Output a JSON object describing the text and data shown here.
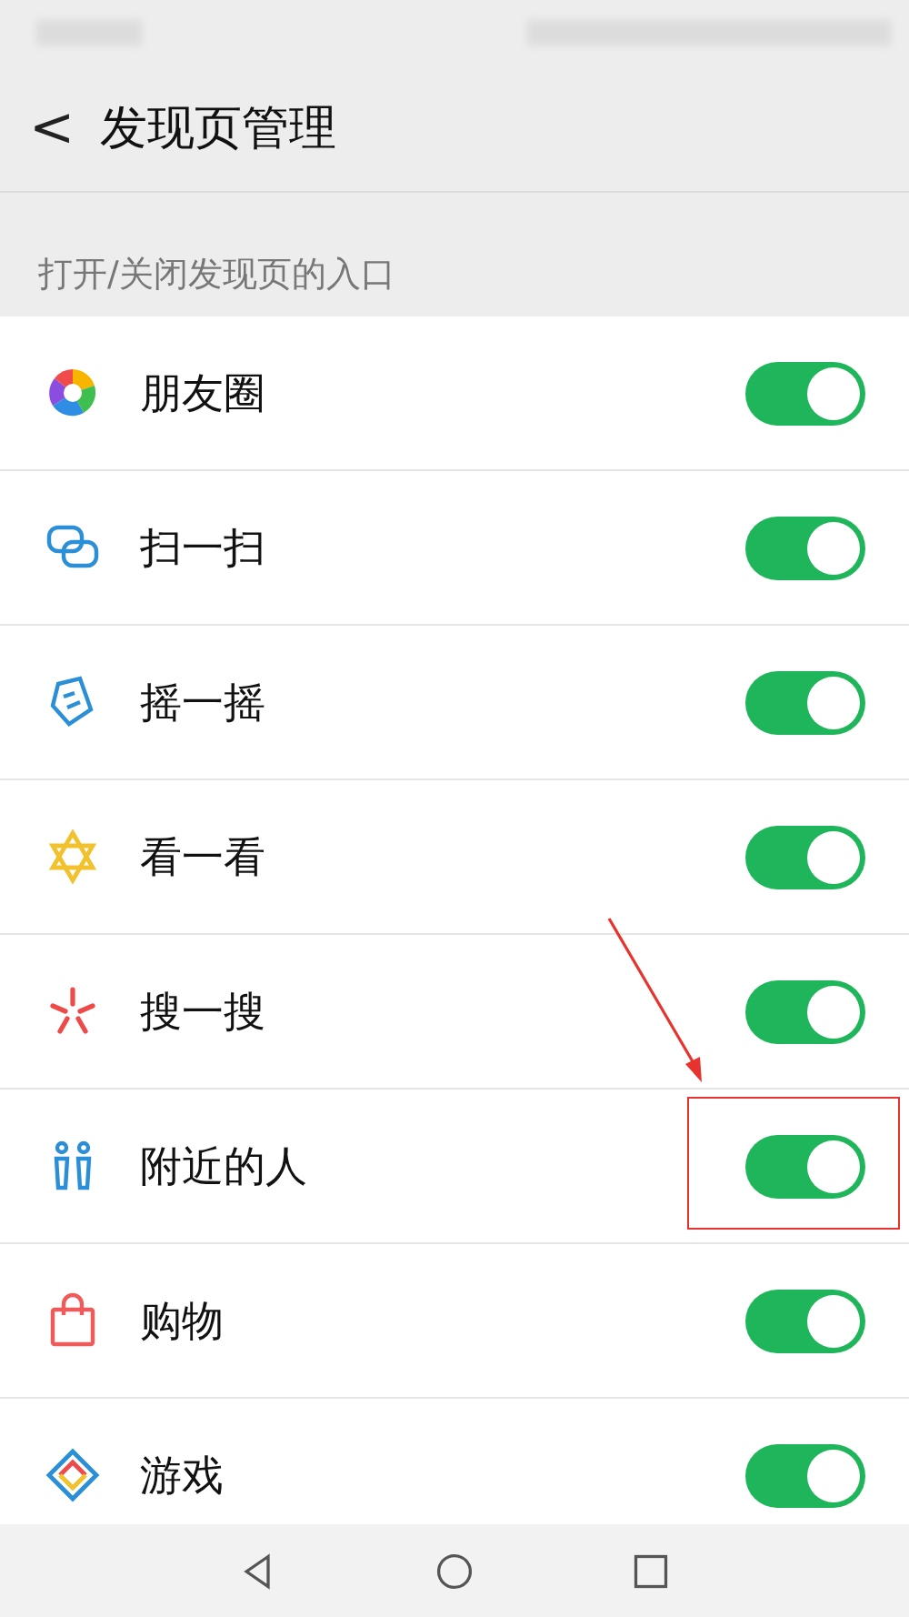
{
  "header": {
    "back": "<",
    "title": "发现页管理"
  },
  "section_label": "打开/关闭发现页的入口",
  "items": [
    {
      "label": "朋友圈",
      "on": true,
      "highlighted": false
    },
    {
      "label": "扫一扫",
      "on": true,
      "highlighted": false
    },
    {
      "label": "摇一摇",
      "on": true,
      "highlighted": false
    },
    {
      "label": "看一看",
      "on": true,
      "highlighted": false
    },
    {
      "label": "搜一搜",
      "on": true,
      "highlighted": false
    },
    {
      "label": "附近的人",
      "on": true,
      "highlighted": true
    },
    {
      "label": "购物",
      "on": true,
      "highlighted": false
    },
    {
      "label": "游戏",
      "on": true,
      "highlighted": false
    }
  ]
}
